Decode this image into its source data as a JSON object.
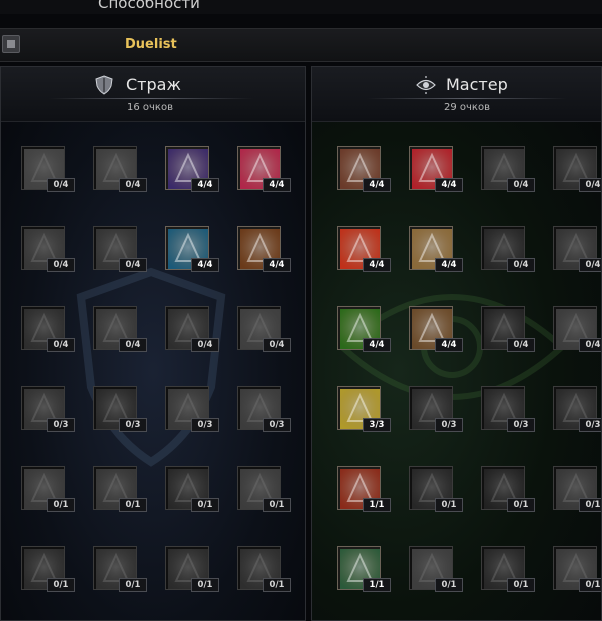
{
  "header": {
    "title": "Способности"
  },
  "class_bar": {
    "name": "Duelist",
    "icon": "class-icon"
  },
  "panels": [
    {
      "key": "guardian",
      "title": "Страж",
      "points": "16 очков",
      "icon": "shield-icon",
      "skills": [
        {
          "level": "0/4",
          "active": false,
          "color": "#8a6a4a",
          "icon": "shield-skill-icon"
        },
        {
          "level": "0/4",
          "active": false,
          "color": "#5a6a7a",
          "icon": "armor-skill-icon"
        },
        {
          "level": "4/4",
          "active": true,
          "color": "#3a2a6a",
          "icon": "demon-skill-icon"
        },
        {
          "level": "4/4",
          "active": true,
          "color": "#b0264a",
          "icon": "orb-skill-icon"
        },
        {
          "level": "0/4",
          "active": false,
          "color": "#a84a2a",
          "icon": "fire-skill-icon"
        },
        {
          "level": "0/4",
          "active": false,
          "color": "#4a5a5a",
          "icon": "wheel-skill-icon"
        },
        {
          "level": "4/4",
          "active": true,
          "color": "#1a5a7a",
          "icon": "cog-skill-icon"
        },
        {
          "level": "4/4",
          "active": true,
          "color": "#6a3a1a",
          "icon": "burst-skill-icon"
        },
        {
          "level": "0/4",
          "active": false,
          "color": "#4a4a5a",
          "icon": "spark-skill-icon"
        },
        {
          "level": "0/4",
          "active": false,
          "color": "#6a5a3a",
          "icon": "arrow-skill-icon"
        },
        {
          "level": "0/4",
          "active": false,
          "color": "#5a4a3a",
          "icon": "helm-skill-icon"
        },
        {
          "level": "0/4",
          "active": false,
          "color": "#6a6a5a",
          "icon": "hood-skill-icon"
        },
        {
          "level": "0/3",
          "active": false,
          "color": "#3a5a6a",
          "icon": "knot-skill-icon"
        },
        {
          "level": "0/3",
          "active": false,
          "color": "#6a3a2a",
          "icon": "slash-skill-icon"
        },
        {
          "level": "0/3",
          "active": false,
          "color": "#3a6a5a",
          "icon": "gem-skill-icon"
        },
        {
          "level": "0/3",
          "active": false,
          "color": "#5a6a4a",
          "icon": "hammer-skill-icon"
        },
        {
          "level": "0/1",
          "active": false,
          "color": "#4a6a2a",
          "icon": "sword-skill-icon"
        },
        {
          "level": "0/1",
          "active": false,
          "color": "#6a5a2a",
          "icon": "eye-skill-icon"
        },
        {
          "level": "0/1",
          "active": false,
          "color": "#5a3a5a",
          "icon": "rune-skill-icon"
        },
        {
          "level": "0/1",
          "active": false,
          "color": "#4a6a7a",
          "icon": "blades-skill-icon"
        },
        {
          "level": "0/1",
          "active": false,
          "color": "#7a3a3a",
          "icon": "cross-skill-icon"
        },
        {
          "level": "0/1",
          "active": false,
          "color": "#6a4a3a",
          "icon": "fist-skill-icon"
        },
        {
          "level": "0/1",
          "active": false,
          "color": "#3a4a5a",
          "icon": "figure-skill-icon"
        },
        {
          "level": "0/1",
          "active": false,
          "color": "#5a4a3a",
          "icon": "totem-skill-icon"
        }
      ]
    },
    {
      "key": "master",
      "title": "Мастер",
      "points": "29 очков",
      "icon": "eye-icon",
      "skills": [
        {
          "level": "4/4",
          "active": true,
          "color": "#6a3a2a",
          "icon": "target-skill-icon"
        },
        {
          "level": "4/4",
          "active": true,
          "color": "#b0202a",
          "icon": "banner-skill-icon"
        },
        {
          "level": "0/4",
          "active": false,
          "color": "#3a5a5a",
          "icon": "crossed-swords-skill-icon"
        },
        {
          "level": "0/4",
          "active": false,
          "color": "#7a3a5a",
          "icon": "dance-skill-icon"
        },
        {
          "level": "4/4",
          "active": true,
          "color": "#c0301a",
          "icon": "flame-skill-icon"
        },
        {
          "level": "4/4",
          "active": true,
          "color": "#8a6a3a",
          "icon": "warrior-skill-icon"
        },
        {
          "level": "0/4",
          "active": false,
          "color": "#5a3a2a",
          "icon": "whip-skill-icon"
        },
        {
          "level": "0/4",
          "active": false,
          "color": "#4a5a5a",
          "icon": "swirl-skill-icon"
        },
        {
          "level": "4/4",
          "active": true,
          "color": "#2a6a1a",
          "icon": "leaf-skill-icon"
        },
        {
          "level": "4/4",
          "active": true,
          "color": "#6a4a2a",
          "icon": "cannon-skill-icon"
        },
        {
          "level": "0/4",
          "active": false,
          "color": "#7a2a2a",
          "icon": "bell-skill-icon"
        },
        {
          "level": "0/4",
          "active": false,
          "color": "#5a6a3a",
          "icon": "shard-skill-icon"
        },
        {
          "level": "3/3",
          "active": true,
          "color": "#b09a2a",
          "icon": "light-skill-icon"
        },
        {
          "level": "0/3",
          "active": false,
          "color": "#5a3a6a",
          "icon": "claw-skill-icon"
        },
        {
          "level": "0/3",
          "active": false,
          "color": "#4a3a5a",
          "icon": "chain-skill-icon"
        },
        {
          "level": "0/3",
          "active": false,
          "color": "#6a3a3a",
          "icon": "face-skill-icon"
        },
        {
          "level": "1/1",
          "active": true,
          "color": "#8a2a1a",
          "icon": "tower-skill-icon"
        },
        {
          "level": "0/1",
          "active": false,
          "color": "#5a3a3a",
          "icon": "beast-skill-icon"
        },
        {
          "level": "0/1",
          "active": false,
          "color": "#6a2a2a",
          "icon": "roar-skill-icon"
        },
        {
          "level": "0/1",
          "active": false,
          "color": "#6a5a4a",
          "icon": "blade-skill-icon"
        },
        {
          "level": "1/1",
          "active": true,
          "color": "#2a5a3a",
          "icon": "gauntlet-skill-icon"
        },
        {
          "level": "0/1",
          "active": false,
          "color": "#6a6a3a",
          "icon": "sun-skill-icon"
        },
        {
          "level": "0/1",
          "active": false,
          "color": "#4a3a6a",
          "icon": "wings-skill-icon"
        },
        {
          "level": "0/1",
          "active": false,
          "color": "#4a6a4a",
          "icon": "silhouette-skill-icon"
        }
      ]
    }
  ]
}
